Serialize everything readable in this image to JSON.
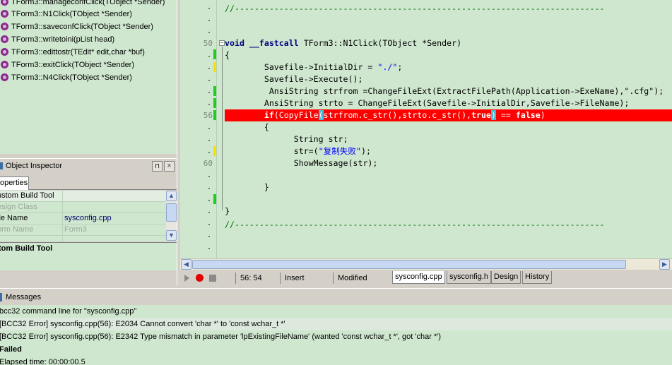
{
  "class_explorer": {
    "items": [
      "TForm3::manageconfClick(TObject *Sender)",
      "TForm3::N1Click(TObject *Sender)",
      "TForm3::saveconfClick(TObject *Sender)",
      "TForm3::writetoini(pList head)",
      "TForm3::edittostr(TEdit* edit,char *buf)",
      "TForm3::exitClick(TObject *Sender)",
      "TForm3::N4Click(TObject *Sender)"
    ],
    "icon": "method-icon"
  },
  "object_inspector": {
    "title": "Object Inspector",
    "tab": "operties",
    "properties": [
      {
        "key": "ustom Build Tool",
        "value": ""
      },
      {
        "key": "esign Class",
        "value": ""
      },
      {
        "key": "ile Name",
        "value": "sysconfig.cpp"
      },
      {
        "key": "orm Name",
        "value": "Form3"
      },
      {
        "key": "",
        "value": ""
      }
    ],
    "description_title": "tom Build Tool"
  },
  "editor": {
    "line_numbers": [
      {
        "label": "50",
        "row": 3
      },
      {
        "label": "56",
        "row": 9
      },
      {
        "label": "60",
        "row": 13
      }
    ],
    "lines": [
      "//---------------------------------------------------------------------------",
      "",
      "",
      "void __fastcall TForm3::N1Click(TObject *Sender)",
      "{",
      "        Savefile->InitialDir = \"./\";",
      "        Savefile->Execute();",
      "         AnsiString strfrom =ChangeFileExt(ExtractFilePath(Application->ExeName),\".cfg\");",
      "        AnsiString strto = ChangeFileExt(Savefile->InitialDir,Savefile->FileName);",
      "        if(CopyFile(strfrom.c_str(),strto.c_str(),true) == false)",
      "        {",
      "              String str;",
      "              str=(\"复制失败\");",
      "              ShowMessage(str);",
      "",
      "        }",
      "",
      "}",
      "//---------------------------------------------------------------------------"
    ],
    "code": {
      "comment": "//---------------------------------------------------------------------------",
      "func_kw": "void",
      "func_cc": "__fastcall",
      "func_rest": " TForm3::N1Click(TObject *Sender)",
      "brace_open": "{",
      "l1a": "        Savefile->InitialDir = ",
      "l1s": "\"./\"",
      "l1b": ";",
      "l2": "        Savefile->Execute();",
      "l3": "         AnsiString strfrom =ChangeFileExt(ExtractFilePath(Application->ExeName),\".cfg\");",
      "l4": "        AnsiString strto = ChangeFileExt(Savefile->InitialDir,Savefile->FileName);",
      "err_a": "        ",
      "err_if": "if",
      "err_b": "(CopyFile",
      "err_c": "(",
      "err_d": "strfrom.c_str(),strto.c_str(),",
      "err_true": "true",
      "err_e": ")",
      "err_f": " == ",
      "err_false": "false",
      "err_g": ")",
      "brace2": "        {",
      "l5": "              String str;",
      "l6a": "              str=(",
      "l6s": "\"复制失败\"",
      "l6b": ");",
      "l7": "              ShowMessage(str);",
      "brace3": "        }",
      "brace_close": "}"
    },
    "error_line": 56
  },
  "editor_status": {
    "position": "56: 54",
    "mode": "Insert",
    "state": "Modified",
    "tabs": [
      "sysconfig.cpp",
      "sysconfig.h",
      "Design",
      "History"
    ],
    "active_tab": "sysconfig.cpp"
  },
  "messages": {
    "title": "Messages",
    "rows": [
      "bcc32 command line for \"sysconfig.cpp\"",
      "[BCC32 Error] sysconfig.cpp(56): E2034 Cannot convert 'char *' to 'const wchar_t *'",
      "[BCC32 Error] sysconfig.cpp(56): E2342 Type mismatch in parameter 'lpExistingFileName' (wanted 'const wchar_t *', got 'char *')",
      "Failed",
      "Elapsed time: 00:00:00.5"
    ]
  },
  "colors": {
    "pane_bg": "#cfe7cf",
    "error_line": "#ff0000",
    "keyword": "#000080",
    "string": "#0000ff",
    "comment": "#007000",
    "modified_mark": "#1ccf1c",
    "unsaved_mark": "#f2e20a"
  }
}
